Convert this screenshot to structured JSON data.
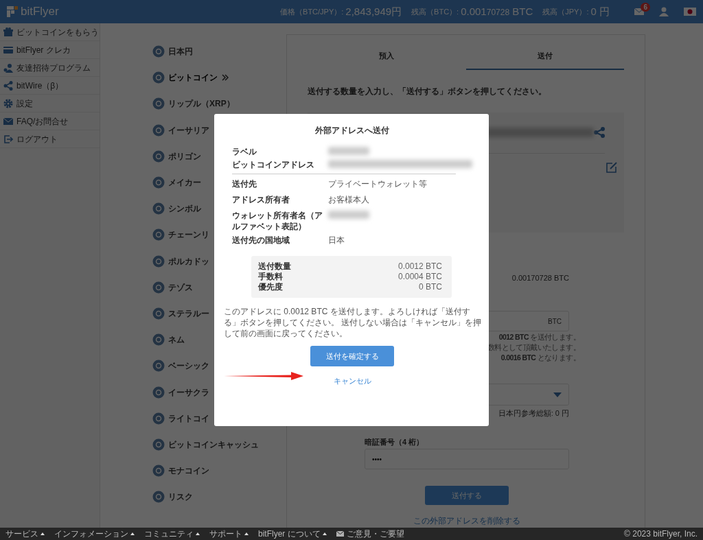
{
  "header": {
    "logo": "bitFlyer",
    "stats": [
      {
        "label": "価格（BTC/JPY）:",
        "value": "2,843,949円"
      },
      {
        "label": "残高（BTC）:",
        "value": "0.001",
        "minor": "70728",
        "unit": "BTC"
      },
      {
        "label": "残高（JPY）:",
        "value": "0 円"
      }
    ],
    "mail_badge": "6"
  },
  "sidebar": {
    "items": [
      {
        "label": "ビットコインをもらう",
        "kind": "gift"
      },
      {
        "label": "bitFlyer クレカ",
        "kind": "card"
      },
      {
        "label": "友達招待プログラム",
        "kind": "people"
      },
      {
        "label": "bitWire（β）",
        "kind": "share"
      },
      {
        "label": "設定",
        "kind": "gear"
      },
      {
        "label": "FAQ/お問合せ",
        "kind": "mail"
      },
      {
        "label": "ログアウト",
        "kind": "logout"
      }
    ]
  },
  "currencies": [
    {
      "name": "日本円",
      "selected": false
    },
    {
      "name": "ビットコイン",
      "selected": true
    },
    {
      "name": "リップル（XRP）",
      "selected": false
    },
    {
      "name": "イーサリア",
      "selected": false
    },
    {
      "name": "ポリゴン",
      "selected": false
    },
    {
      "name": "メイカー",
      "selected": false
    },
    {
      "name": "シンボル",
      "selected": false
    },
    {
      "name": "チェーンリ",
      "selected": false
    },
    {
      "name": "ポルカドッ",
      "selected": false
    },
    {
      "name": "テゾス",
      "selected": false
    },
    {
      "name": "ステラルー",
      "selected": false
    },
    {
      "name": "ネム",
      "selected": false
    },
    {
      "name": "ベーシック",
      "selected": false
    },
    {
      "name": "イーサクラ",
      "selected": false
    },
    {
      "name": "ライトコイ",
      "selected": false
    },
    {
      "name": "ビットコインキャッシュ",
      "selected": false
    },
    {
      "name": "モナコイン",
      "selected": false
    },
    {
      "name": "リスク",
      "selected": false
    }
  ],
  "tabs": [
    {
      "label": "預入",
      "selected": false
    },
    {
      "label": "送付",
      "selected": true
    }
  ],
  "send_form": {
    "instruction": "送付する数量を入力し、「送付する」ボタンを押してください。",
    "balance": "0.00170728 BTC",
    "amount_unit": "BTC",
    "hints": [
      "**0012 BTC** を送付します。",
      "数料として頂戴いたします。",
      "**0.0016 BTC** となります。"
    ],
    "jpy_total": "日本円参考総額: 0 円",
    "pin_label": "暗証番号（4 桁）",
    "pin_value": "••••",
    "submit": "送付する",
    "delete_link": "この外部アドレスを削除する"
  },
  "modal": {
    "title": "外部アドレスへ送付",
    "address_rows": [
      {
        "label": "ラベル",
        "kind": "blurred"
      },
      {
        "label": "ビットコインアドレス",
        "kind": "blurred"
      }
    ],
    "detail_rows": [
      {
        "label": "送付先",
        "kind": "text",
        "value": "プライベートウォレット等"
      },
      {
        "label": "アドレス所有者",
        "kind": "text",
        "value": "お客様本人"
      },
      {
        "label": "ウォレット所有者名（アルファベット表記）",
        "kind": "blurred"
      },
      {
        "label": "送付先の国地域",
        "kind": "text",
        "value": "日本"
      }
    ],
    "summary": [
      {
        "label": "送付数量",
        "value": "0.0012 BTC"
      },
      {
        "label": "手数料",
        "value": "0.0004 BTC"
      },
      {
        "label": "優先度",
        "value": "0 BTC"
      }
    ],
    "message": "このアドレスに 0.0012 BTC を送付します。よろしければ「送付する」ボタンを押してください。 送付しない場合は「キャンセル」を押して前の画面に戻ってください。",
    "confirm": "送付を確定する",
    "cancel": "キャンセル"
  },
  "footer": {
    "menus": [
      "サービス",
      "インフォメーション",
      "コミュニティ",
      "サポート",
      "bitFlyer について"
    ],
    "feedback": "ご意見・ご要望",
    "copyright": "© 2023 bitFlyer, Inc."
  }
}
